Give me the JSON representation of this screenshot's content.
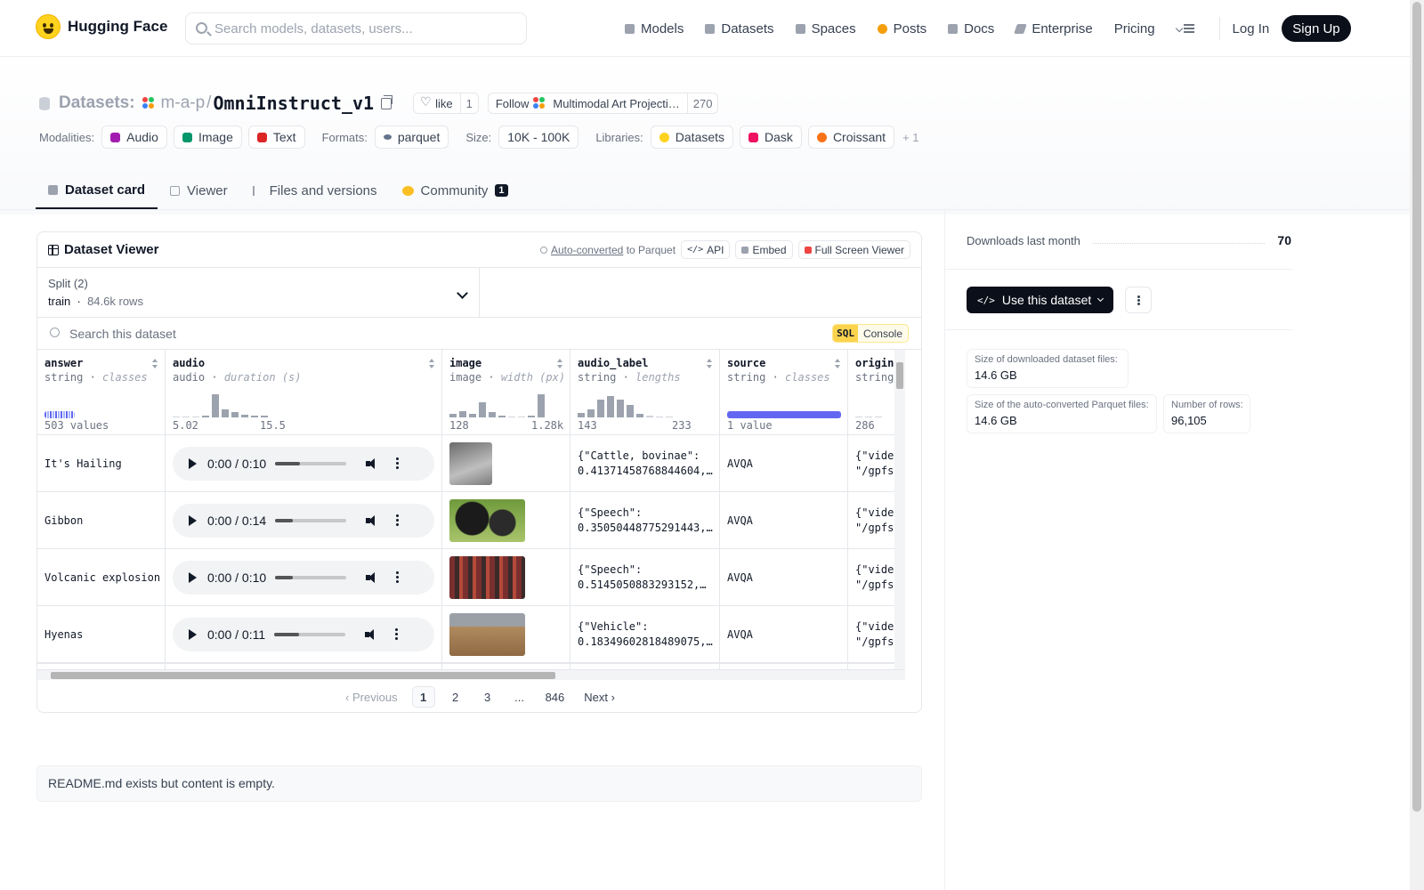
{
  "header": {
    "brand": "Hugging Face",
    "search_placeholder": "Search models, datasets, users...",
    "nav": [
      {
        "label": "Models",
        "icon": "cube-icon"
      },
      {
        "label": "Datasets",
        "icon": "database-icon"
      },
      {
        "label": "Spaces",
        "icon": "grid-icon"
      },
      {
        "label": "Posts",
        "icon": "posts-icon"
      },
      {
        "label": "Docs",
        "icon": "docs-icon"
      },
      {
        "label": "Enterprise",
        "icon": "enterprise-icon"
      },
      {
        "label": "Pricing"
      }
    ],
    "login": "Log In",
    "signup": "Sign Up"
  },
  "dataset": {
    "section": "Datasets:",
    "org": "m-a-p",
    "slash": "/",
    "name": "OmniInstruct_v1",
    "like_label": "like",
    "like_count": "1",
    "follow_label": "Follow",
    "follow_org": "Multimodal Art Projecti…",
    "follow_count": "270",
    "modalities_label": "Modalities:",
    "modalities": [
      "Audio",
      "Image",
      "Text"
    ],
    "formats_label": "Formats:",
    "format": "parquet",
    "size_label": "Size:",
    "size": "10K - 100K",
    "libraries_label": "Libraries:",
    "libraries": [
      "Datasets",
      "Dask",
      "Croissant"
    ],
    "libraries_more": "+ 1"
  },
  "tabs": [
    {
      "label": "Dataset card",
      "active": true
    },
    {
      "label": "Viewer"
    },
    {
      "label": "Files and versions"
    },
    {
      "label": "Community",
      "badge": "1"
    }
  ],
  "viewer": {
    "title": "Dataset Viewer",
    "auto_link": "Auto-converted",
    "auto_rest": "to Parquet",
    "api": "API",
    "embed": "Embed",
    "fullscreen": "Full Screen Viewer",
    "split_label": "Split (2)",
    "split_value": "train",
    "split_rows": "84.6k rows",
    "search_placeholder": "Search this dataset",
    "sql_tag": "SQL",
    "sql_label": "Console",
    "columns": [
      {
        "name": "answer",
        "type": "string",
        "sub": "classes",
        "stat_left": "503 values",
        "stat_right": ""
      },
      {
        "name": "audio",
        "type": "audio",
        "sub": "duration (s)",
        "stat_left": "5.02",
        "stat_right": "15.5"
      },
      {
        "name": "image",
        "type": "image",
        "sub": "width (px)",
        "stat_left": "128",
        "stat_right": "1.28k"
      },
      {
        "name": "audio_label",
        "type": "string",
        "sub": "lengths",
        "stat_left": "143",
        "stat_right": "233"
      },
      {
        "name": "source",
        "type": "string",
        "sub": "classes",
        "stat_left": "1 value",
        "stat_right": ""
      },
      {
        "name": "origin",
        "type": "string",
        "sub": "",
        "stat_left": "286",
        "stat_right": ""
      }
    ],
    "rows": [
      {
        "answer": "It's Hailing",
        "time": "0:00 / 0:10",
        "label1": "{\"Cattle, bovinae\":",
        "label2": "0.41371458768844604,…",
        "source": "AVQA",
        "origin1": "{\"vide",
        "origin2": "\"/gpfs"
      },
      {
        "answer": "Gibbon",
        "time": "0:00 / 0:14",
        "label1": "{\"Speech\":",
        "label2": "0.35050448775291443,…",
        "source": "AVQA",
        "origin1": "{\"vide",
        "origin2": "\"/gpfs"
      },
      {
        "answer": "Volcanic explosion",
        "time": "0:00 / 0:10",
        "label1": "{\"Speech\":",
        "label2": "0.5145050883293152,…",
        "source": "AVQA",
        "origin1": "{\"vide",
        "origin2": "\"/gpfs"
      },
      {
        "answer": "Hyenas",
        "time": "0:00 / 0:11",
        "label1": "{\"Vehicle\":",
        "label2": "0.18349602818489075,…",
        "source": "AVQA",
        "origin1": "{\"vide",
        "origin2": "\"/gpfs"
      }
    ],
    "pager": {
      "prev": "Previous",
      "pages": [
        "1",
        "2",
        "3",
        "...",
        "846"
      ],
      "next": "Next"
    }
  },
  "readme": "README.md exists but content is empty.",
  "sidebar": {
    "downloads_label": "Downloads last month",
    "downloads_value": "70",
    "use_label": "Use this dataset",
    "stats": [
      {
        "k": "Size of downloaded dataset files:",
        "v": "14.6 GB"
      },
      {
        "k": "Size of the auto-converted Parquet files:",
        "v": "14.6 GB"
      },
      {
        "k": "Number of rows:",
        "v": "96,105"
      }
    ]
  },
  "colors": {
    "accent": "#6366f1",
    "dark": "#0b0f19",
    "hf_yellow": "#ffd21e"
  }
}
